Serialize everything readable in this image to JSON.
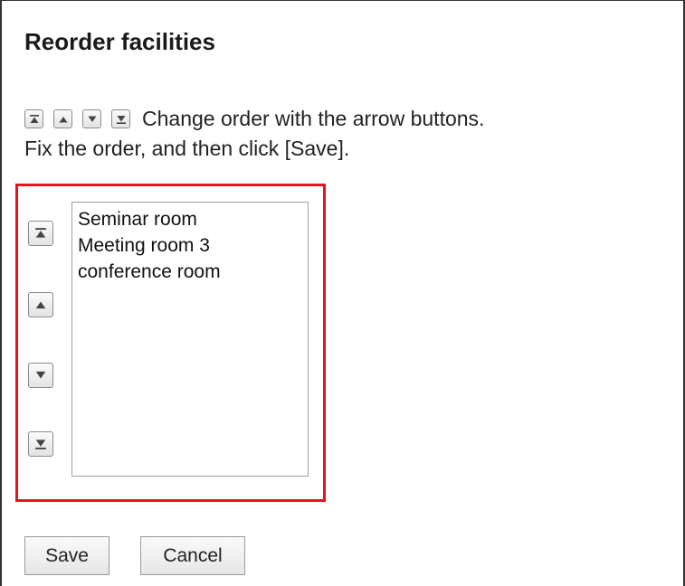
{
  "dialog": {
    "title": "Reorder facilities",
    "instruction_line1": "Change order with the arrow buttons.",
    "instruction_line2": "Fix the order, and then click [Save]."
  },
  "facilities": [
    "Seminar room",
    "Meeting room 3",
    "conference room"
  ],
  "buttons": {
    "save": "Save",
    "cancel": "Cancel"
  },
  "icons": {
    "move_top": "move-to-top-icon",
    "move_up": "move-up-icon",
    "move_down": "move-down-icon",
    "move_bottom": "move-to-bottom-icon"
  },
  "colors": {
    "highlight_border": "#e8141d"
  }
}
